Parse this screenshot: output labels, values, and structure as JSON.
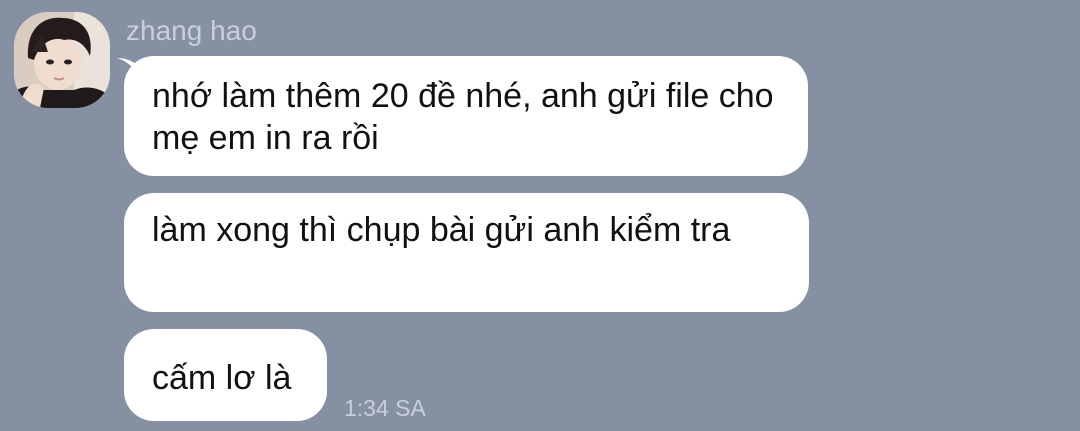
{
  "chat": {
    "sender_name": "zhang hao",
    "avatar_icon": "user-photo-avatar",
    "messages": [
      {
        "text": "nhớ làm thêm 20 đề nhé, anh gửi file cho mẹ em in ra rồi"
      },
      {
        "text": "làm xong thì chụp bài gửi anh kiểm tra"
      },
      {
        "text": "cấm lơ là"
      }
    ],
    "timestamp": "1:34 SA"
  },
  "colors": {
    "background": "#8590a3",
    "bubble": "#ffffff",
    "meta_text": "#c9cfd9",
    "message_text": "#111111"
  }
}
